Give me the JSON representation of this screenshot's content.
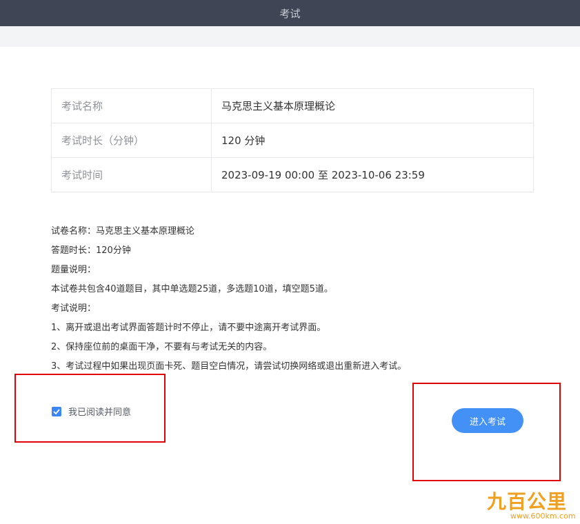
{
  "header": {
    "title": "考试"
  },
  "exam_info": {
    "rows": [
      {
        "label": "考试名称",
        "value": "马克思主义基本原理概论"
      },
      {
        "label": "考试时长（分钟）",
        "value": "120 分钟"
      },
      {
        "label": "考试时间",
        "value": "2023-09-19 00:00 至 2023-10-06 23:59"
      }
    ]
  },
  "description": {
    "lines": [
      "试卷名称：马克思主义基本原理概论",
      "答题时长：120分钟",
      "题量说明：",
      "本试卷共包含40道题目，其中单选题25道，多选题10道，填空题5道。",
      "考试说明：",
      "1、离开或退出考试界面答题计时不停止，请不要中途离开考试界面。",
      "2、保持座位前的桌面干净，不要有与考试无关的内容。",
      "3、考试过程中如果出现页面卡死、题目空白情况，请尝试切换网络或退出重新进入考试。"
    ]
  },
  "agreement": {
    "label": "我已阅读并同意",
    "checked": true
  },
  "actions": {
    "enter_label": "进入考试"
  },
  "watermark": {
    "brand": "九百公里",
    "url": "www.600km.com"
  },
  "colors": {
    "accent": "#4390f6",
    "header_bg": "#3f4555",
    "highlight": "#e00000"
  }
}
